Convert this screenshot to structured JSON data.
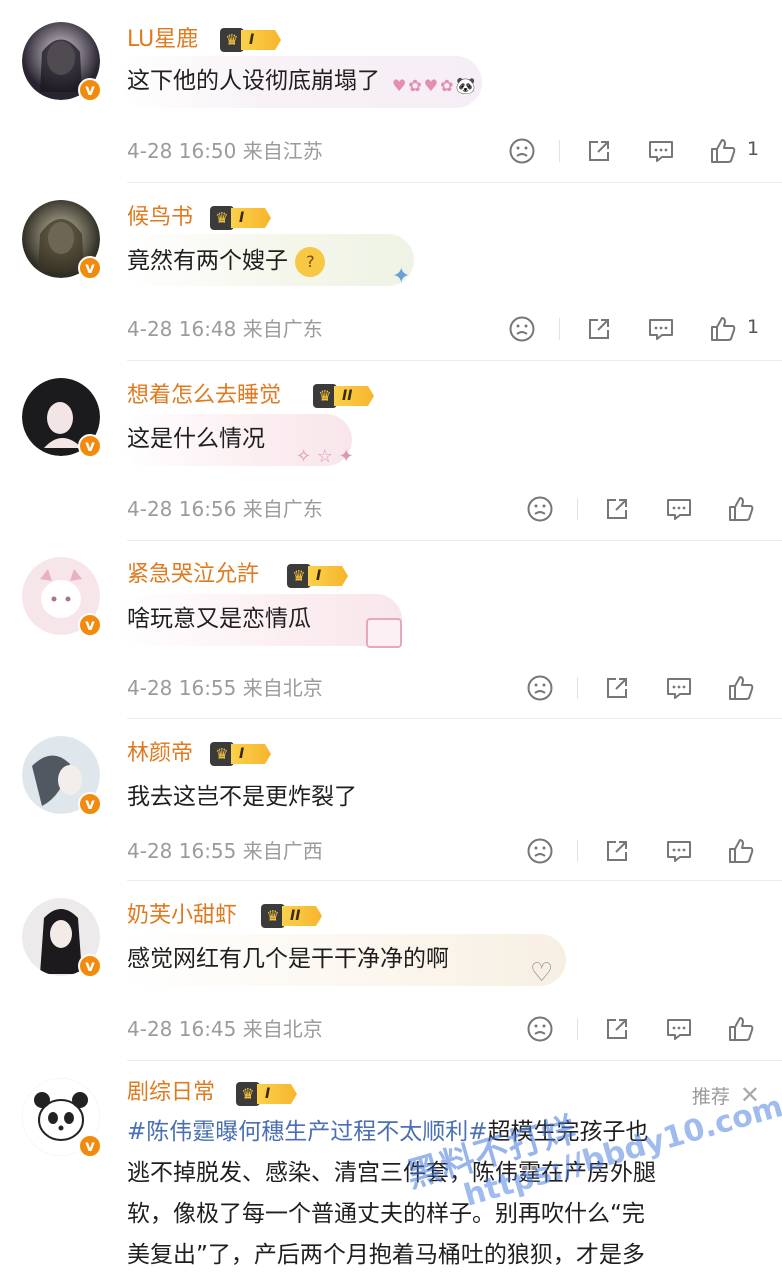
{
  "comments": [
    {
      "username": "LU星鹿",
      "level": "I",
      "text": "这下他的人设彻底崩塌了",
      "time": "4-28 16:50",
      "location": "来自江苏",
      "likes": "1"
    },
    {
      "username": "候鸟书",
      "level": "I",
      "text": "竟然有两个嫂子",
      "time": "4-28 16:48",
      "location": "来自广东",
      "likes": "1"
    },
    {
      "username": "想着怎么去睡觉",
      "level": "II",
      "text": "这是什么情况",
      "time": "4-28 16:56",
      "location": "来自广东",
      "likes": ""
    },
    {
      "username": "紧急哭泣允許",
      "level": "I",
      "text": "啥玩意又是恋情瓜",
      "time": "4-28 16:55",
      "location": "来自北京",
      "likes": ""
    },
    {
      "username": "林颜帝",
      "level": "I",
      "text": "我去这岂不是更炸裂了",
      "time": "4-28 16:55",
      "location": "来自广西",
      "likes": ""
    },
    {
      "username": "奶芙小甜虾",
      "level": "II",
      "text": "感觉网红有几个是干干净净的啊",
      "time": "4-28 16:45",
      "location": "来自北京",
      "likes": ""
    }
  ],
  "post": {
    "username": "剧综日常",
    "level": "I",
    "recommend_label": "推荐",
    "hashtag": "#陈伟霆曝何穗生产过程不太顺利#",
    "text_line1_rest": "超模生完孩子也",
    "line2": "逃不掉脱发、感染、清宫三件套，陈伟霆在产房外腿",
    "line3": "软，像极了每一个普通丈夫的样子。别再吹什么“完",
    "line4": "美复出”了，产后两个月抱着马桶吐的狼狈，才是多"
  },
  "watermark": {
    "line1": "黑料不打烊",
    "line2": "https://bbdy10.com"
  },
  "icons": {
    "dislike": "frown-face-icon",
    "share": "share-icon",
    "comment": "comment-bubble-icon",
    "like": "thumbs-up-icon",
    "verified": "verified-v-badge-icon",
    "crown": "crown-icon",
    "close": "close-x-icon"
  },
  "colors": {
    "username": "#e07a1f",
    "hashtag": "#4a6fb3",
    "meta": "#9b9b9b",
    "badge": "#f28a0e"
  }
}
